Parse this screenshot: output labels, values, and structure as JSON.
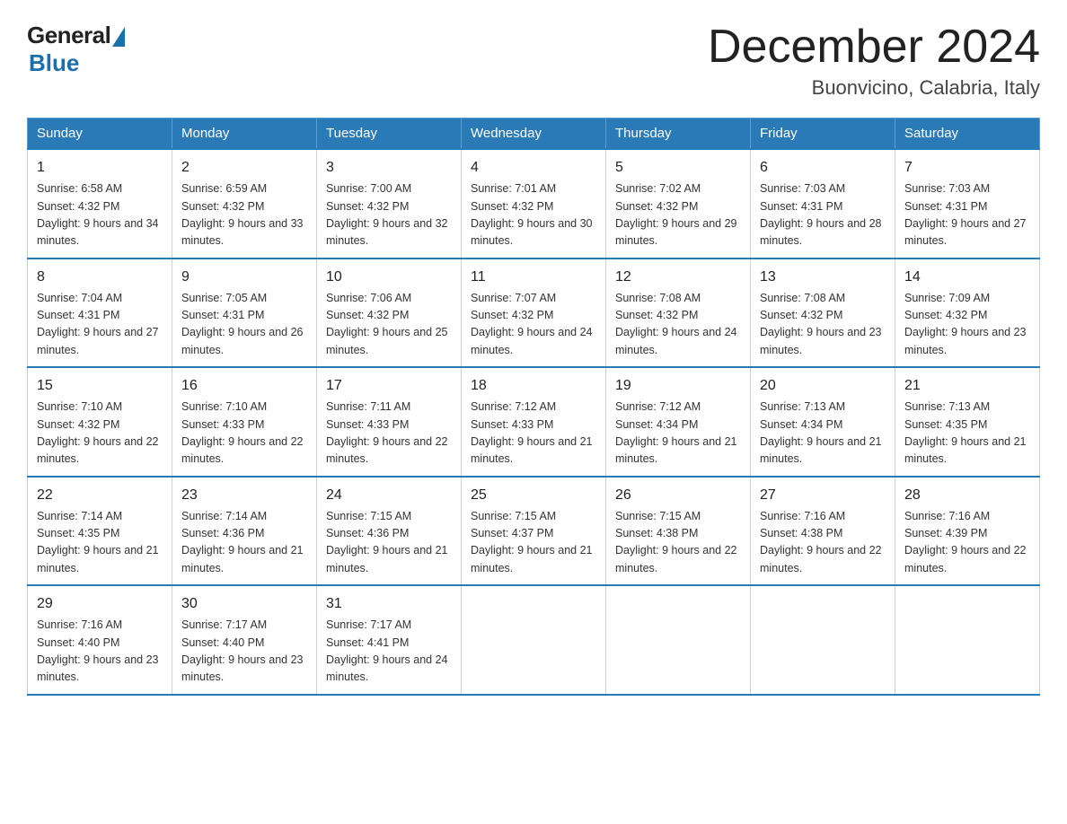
{
  "header": {
    "logo_general": "General",
    "logo_blue": "Blue",
    "title": "December 2024",
    "subtitle": "Buonvicino, Calabria, Italy"
  },
  "days_of_week": [
    "Sunday",
    "Monday",
    "Tuesday",
    "Wednesday",
    "Thursday",
    "Friday",
    "Saturday"
  ],
  "weeks": [
    [
      {
        "num": "1",
        "rise": "6:58 AM",
        "set": "4:32 PM",
        "daylight": "9 hours and 34 minutes."
      },
      {
        "num": "2",
        "rise": "6:59 AM",
        "set": "4:32 PM",
        "daylight": "9 hours and 33 minutes."
      },
      {
        "num": "3",
        "rise": "7:00 AM",
        "set": "4:32 PM",
        "daylight": "9 hours and 32 minutes."
      },
      {
        "num": "4",
        "rise": "7:01 AM",
        "set": "4:32 PM",
        "daylight": "9 hours and 30 minutes."
      },
      {
        "num": "5",
        "rise": "7:02 AM",
        "set": "4:32 PM",
        "daylight": "9 hours and 29 minutes."
      },
      {
        "num": "6",
        "rise": "7:03 AM",
        "set": "4:31 PM",
        "daylight": "9 hours and 28 minutes."
      },
      {
        "num": "7",
        "rise": "7:03 AM",
        "set": "4:31 PM",
        "daylight": "9 hours and 27 minutes."
      }
    ],
    [
      {
        "num": "8",
        "rise": "7:04 AM",
        "set": "4:31 PM",
        "daylight": "9 hours and 27 minutes."
      },
      {
        "num": "9",
        "rise": "7:05 AM",
        "set": "4:31 PM",
        "daylight": "9 hours and 26 minutes."
      },
      {
        "num": "10",
        "rise": "7:06 AM",
        "set": "4:32 PM",
        "daylight": "9 hours and 25 minutes."
      },
      {
        "num": "11",
        "rise": "7:07 AM",
        "set": "4:32 PM",
        "daylight": "9 hours and 24 minutes."
      },
      {
        "num": "12",
        "rise": "7:08 AM",
        "set": "4:32 PM",
        "daylight": "9 hours and 24 minutes."
      },
      {
        "num": "13",
        "rise": "7:08 AM",
        "set": "4:32 PM",
        "daylight": "9 hours and 23 minutes."
      },
      {
        "num": "14",
        "rise": "7:09 AM",
        "set": "4:32 PM",
        "daylight": "9 hours and 23 minutes."
      }
    ],
    [
      {
        "num": "15",
        "rise": "7:10 AM",
        "set": "4:32 PM",
        "daylight": "9 hours and 22 minutes."
      },
      {
        "num": "16",
        "rise": "7:10 AM",
        "set": "4:33 PM",
        "daylight": "9 hours and 22 minutes."
      },
      {
        "num": "17",
        "rise": "7:11 AM",
        "set": "4:33 PM",
        "daylight": "9 hours and 22 minutes."
      },
      {
        "num": "18",
        "rise": "7:12 AM",
        "set": "4:33 PM",
        "daylight": "9 hours and 21 minutes."
      },
      {
        "num": "19",
        "rise": "7:12 AM",
        "set": "4:34 PM",
        "daylight": "9 hours and 21 minutes."
      },
      {
        "num": "20",
        "rise": "7:13 AM",
        "set": "4:34 PM",
        "daylight": "9 hours and 21 minutes."
      },
      {
        "num": "21",
        "rise": "7:13 AM",
        "set": "4:35 PM",
        "daylight": "9 hours and 21 minutes."
      }
    ],
    [
      {
        "num": "22",
        "rise": "7:14 AM",
        "set": "4:35 PM",
        "daylight": "9 hours and 21 minutes."
      },
      {
        "num": "23",
        "rise": "7:14 AM",
        "set": "4:36 PM",
        "daylight": "9 hours and 21 minutes."
      },
      {
        "num": "24",
        "rise": "7:15 AM",
        "set": "4:36 PM",
        "daylight": "9 hours and 21 minutes."
      },
      {
        "num": "25",
        "rise": "7:15 AM",
        "set": "4:37 PM",
        "daylight": "9 hours and 21 minutes."
      },
      {
        "num": "26",
        "rise": "7:15 AM",
        "set": "4:38 PM",
        "daylight": "9 hours and 22 minutes."
      },
      {
        "num": "27",
        "rise": "7:16 AM",
        "set": "4:38 PM",
        "daylight": "9 hours and 22 minutes."
      },
      {
        "num": "28",
        "rise": "7:16 AM",
        "set": "4:39 PM",
        "daylight": "9 hours and 22 minutes."
      }
    ],
    [
      {
        "num": "29",
        "rise": "7:16 AM",
        "set": "4:40 PM",
        "daylight": "9 hours and 23 minutes."
      },
      {
        "num": "30",
        "rise": "7:17 AM",
        "set": "4:40 PM",
        "daylight": "9 hours and 23 minutes."
      },
      {
        "num": "31",
        "rise": "7:17 AM",
        "set": "4:41 PM",
        "daylight": "9 hours and 24 minutes."
      },
      null,
      null,
      null,
      null
    ]
  ]
}
